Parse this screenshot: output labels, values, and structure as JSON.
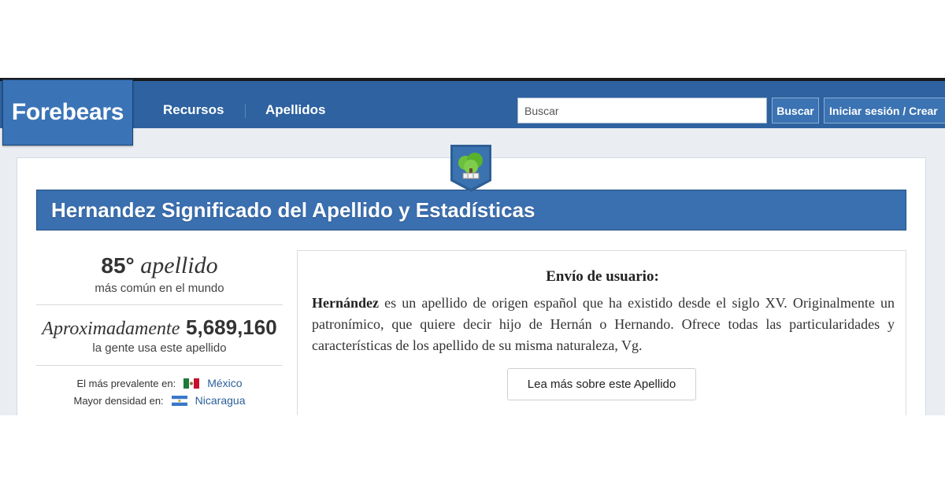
{
  "header": {
    "logo": "Forebears",
    "nav": [
      "Recursos",
      "Apellidos"
    ],
    "search_placeholder": "Buscar",
    "search_button": "Buscar",
    "login_button": "Iniciar sesión / Crear"
  },
  "page": {
    "title": "Hernandez Significado del Apellido y Estadísticas"
  },
  "stats": {
    "rank_number": "85°",
    "rank_word": "apellido",
    "rank_caption": "más común en el mundo",
    "approx_word": "Aproximadamente",
    "count": "5,689,160",
    "count_caption": "la gente usa este apellido",
    "prevalent_label": "El más prevalente en:",
    "prevalent_country": "México",
    "density_label": "Mayor densidad en:",
    "density_country": "Nicaragua"
  },
  "submission": {
    "heading": "Envío de usuario:",
    "name": "Hernández",
    "text": "es un apellido de origen español que ha existido desde el siglo XV. Originalmente un patronímico, que quiere decir hijo de Hernán o Hernando. Ofrece todas las particularidades y características de los apellido de su misma naturaleza, Vg.",
    "more_button": "Lea más sobre este Apellido"
  },
  "icons": {
    "emblem": "tree-book-icon",
    "flag_1": "mexico-flag-icon",
    "flag_2": "nicaragua-flag-icon"
  },
  "colors": {
    "navbar": "#2e62a0",
    "title_bar": "#3a6fb0",
    "link": "#2c5f99"
  }
}
